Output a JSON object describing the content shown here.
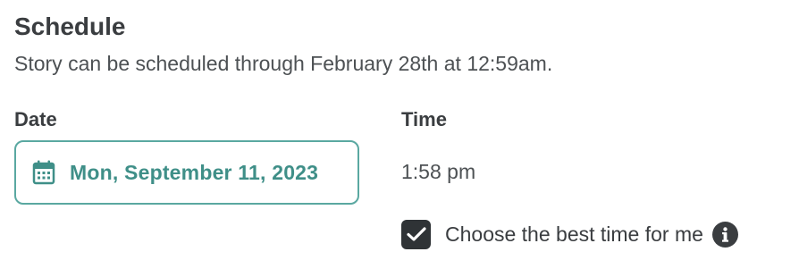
{
  "schedule": {
    "title": "Schedule",
    "subtitle": "Story can be scheduled through February 28th at 12:59am."
  },
  "date": {
    "label": "Date",
    "value": "Mon, September 11, 2023",
    "icon": "calendar-icon"
  },
  "time": {
    "label": "Time",
    "value": "1:58 pm"
  },
  "best_time": {
    "label": "Choose the best time for me",
    "checked": true,
    "icon": "info-icon"
  },
  "colors": {
    "accent": "#3f8f88",
    "accent_border": "#5aa8a1",
    "text": "#3a3d40",
    "checkbox": "#2f3336"
  }
}
